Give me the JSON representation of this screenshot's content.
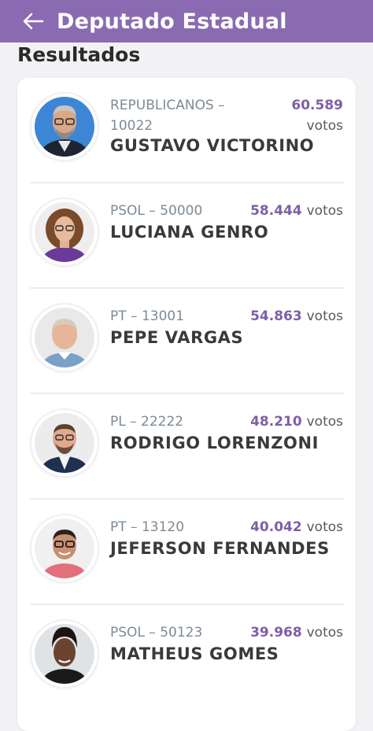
{
  "header": {
    "title": "Deputado Estadual",
    "back_icon": "arrow-left-icon",
    "color": "#8a6bb1"
  },
  "section_title": "Resultados",
  "accent_color": "#7e5ea8",
  "candidates": [
    {
      "party": "REPUBLICANOS – 10022",
      "votes": "60.589",
      "votes_unit": "votos",
      "name": "GUSTAVO VICTORINO",
      "photo_icon": "candidate-photo-icon"
    },
    {
      "party": "PSOL – 50000",
      "votes": "58.444",
      "votes_unit": "votos",
      "name": "LUCIANA GENRO",
      "photo_icon": "candidate-photo-icon"
    },
    {
      "party": "PT – 13001",
      "votes": "54.863",
      "votes_unit": "votos",
      "name": "PEPE VARGAS",
      "photo_icon": "candidate-photo-icon"
    },
    {
      "party": "PL – 22222",
      "votes": "48.210",
      "votes_unit": "votos",
      "name": "RODRIGO LORENZONI",
      "photo_icon": "candidate-photo-icon"
    },
    {
      "party": "PT – 13120",
      "votes": "40.042",
      "votes_unit": "votos",
      "name": "JEFERSON FERNANDES",
      "photo_icon": "candidate-photo-icon"
    },
    {
      "party": "PSOL – 50123",
      "votes": "39.968",
      "votes_unit": "votos",
      "name": "MATHEUS GOMES",
      "photo_icon": "candidate-photo-icon"
    }
  ]
}
